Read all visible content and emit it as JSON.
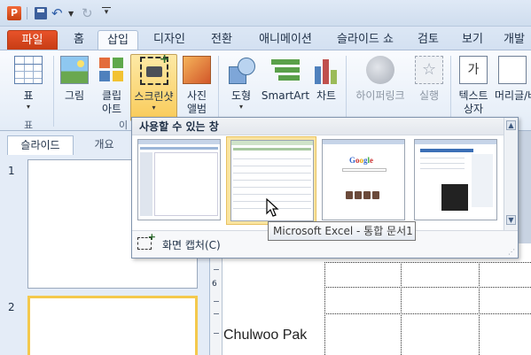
{
  "qat": {
    "app_icon_letter": "P",
    "customize_glyph": "▾",
    "undo_glyph": "↶",
    "redo_glyph": "↻"
  },
  "tabs": [
    {
      "label": "파일",
      "kind": "file"
    },
    {
      "label": "홈",
      "kind": "normal"
    },
    {
      "label": "삽입",
      "kind": "active"
    },
    {
      "label": "디자인",
      "kind": "normal"
    },
    {
      "label": "전환",
      "kind": "normal"
    },
    {
      "label": "애니메이션",
      "kind": "normal"
    },
    {
      "label": "슬라이드 쇼",
      "kind": "normal"
    },
    {
      "label": "검토",
      "kind": "normal"
    },
    {
      "label": "보기",
      "kind": "normal"
    },
    {
      "label": "개발",
      "kind": "normal"
    }
  ],
  "ribbon": {
    "table": {
      "label": "표",
      "group": "표"
    },
    "picture": {
      "label": "그림"
    },
    "clipart": {
      "line1": "클립",
      "line2": "아트"
    },
    "screenshot": {
      "label": "스크린샷"
    },
    "photoalbum": {
      "line1": "사진",
      "line2": "앨범"
    },
    "images_group_fragment": "이",
    "shapes": {
      "label": "도형"
    },
    "smartart": {
      "label": "SmartArt"
    },
    "chart": {
      "label": "차트"
    },
    "hyperlink": {
      "label": "하이퍼링크"
    },
    "action": {
      "label": "실행"
    },
    "textbox": {
      "line1": "텍스트",
      "line2": "상자",
      "icon_text": "가"
    },
    "headerfooter": {
      "label": "머리글/바"
    }
  },
  "left_panel": {
    "tab_slides": "슬라이드",
    "tab_outline": "개요",
    "slide_numbers": [
      "1",
      "2"
    ]
  },
  "dropdown": {
    "header": "사용할 수 있는 창",
    "screen_clipping_label": "화면 캡처(C)"
  },
  "tooltip": {
    "text": "Microsoft Excel - 통합 문서1"
  },
  "slide": {
    "author": "Chulwoo Pak",
    "ruler_mark": "6"
  },
  "colors": {
    "file_tab": "#d4481f",
    "highlight": "#f9cb59",
    "ribbon_bg": "#e3ecf7"
  }
}
